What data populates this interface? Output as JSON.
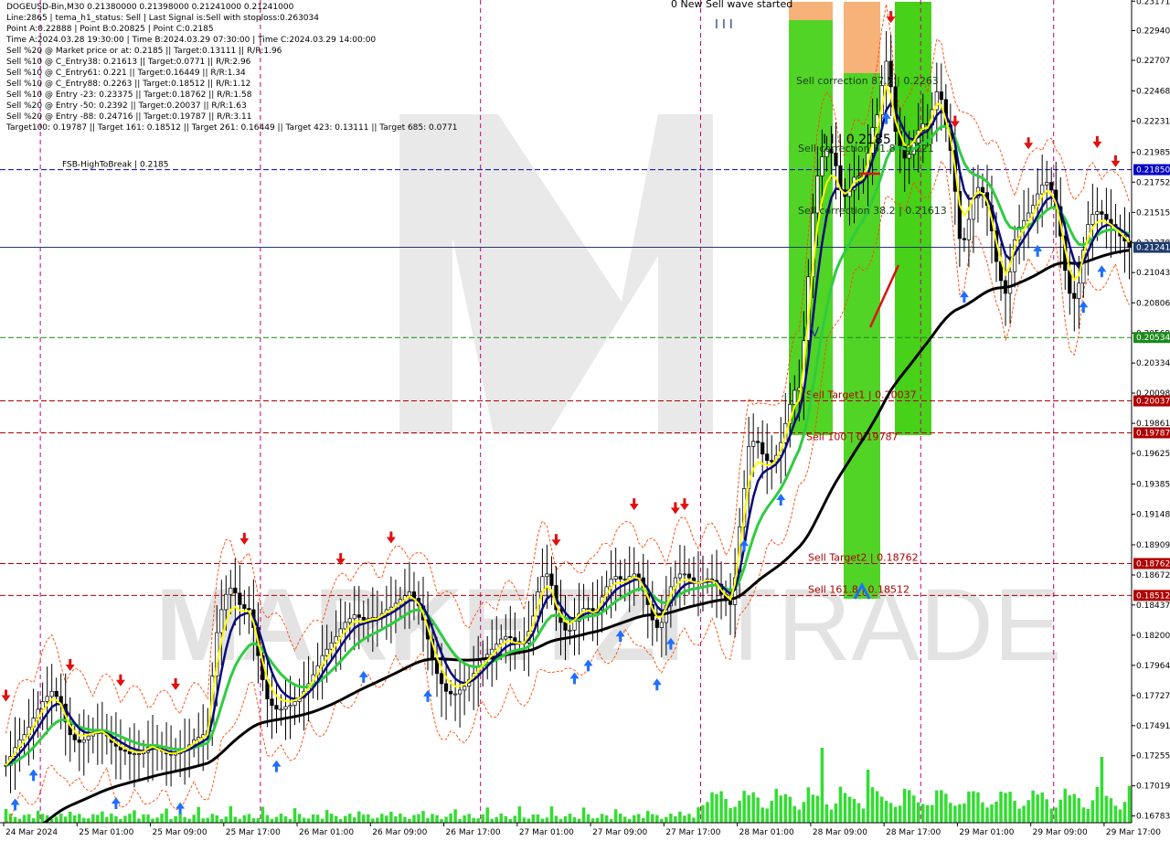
{
  "header": {
    "lines": [
      "DOGEUSD-Bin,M30  0.21380000 0.21398000 0.21241000 0.21241000",
      "Line:2865 | tema_h1_status: Sell | Last Signal is:Sell with stoploss:0.263034",
      "Point A:0.22888 | Point B:0.20825 | Point C:0.2185",
      "Time A:2024.03.28 19:30:00 | Time B:2024.03.29 07:30:00 | Time C:2024.03.29 14:00:00",
      "Sell %20 @ Market price or at: 0.2185 || Target:0.13111 || R/R:1.96",
      "Sell %10 @ C_Entry38: 0.21613 || Target:0.0771 || R/R:2.96",
      "Sell %10 @ C_Entry61: 0.221 || Target:0.16449 || R/R:1.34",
      "Sell %10 @ C_Entry88: 0.2263 || Target:0.18512 || R/R:1.12",
      "Sell %10 @ Entry -23: 0.23375 || Target:0.18762 || R/R:1.58",
      "Sell %20 @ Entry -50: 0.2392 || Target:0.20037 || R/R:1.63",
      "Sell %20 @ Entry -88: 0.24716 || Target:0.19787 || R/R:3.11",
      "Target100: 0.19787 || Target 161: 0.18512 || Target 261: 0.16449 || Target 423: 0.13111 || Target 685: 0.0771"
    ]
  },
  "watermark": {
    "bold": "MARKETZI",
    "light": "TRADE"
  },
  "chart_data": {
    "type": "candlestick",
    "symbol": "DOGEUSD-Bin",
    "timeframe": "M30",
    "ohlc_last": {
      "open": 0.2138,
      "high": 0.21398,
      "low": 0.21241,
      "close": 0.21241
    },
    "current_price": 0.21241,
    "ylim": [
      0.1673,
      0.2318
    ],
    "y_ticks": [
      "0.23171",
      "0.22940",
      "0.22707",
      "0.22468",
      "0.22231",
      "0.21985",
      "0.21752",
      "0.21515",
      "0.21278",
      "0.21043",
      "0.20806",
      "0.20569",
      "0.20334",
      "0.20098",
      "0.19861",
      "0.19625",
      "0.19385",
      "0.19148",
      "0.18909",
      "0.18672",
      "0.18437",
      "0.18200",
      "0.17964",
      "0.17727",
      "0.17491",
      "0.17255",
      "0.17019",
      "0.16783"
    ],
    "y_tick_values": [
      0.23171,
      0.2294,
      0.22707,
      0.22468,
      0.22231,
      0.21985,
      0.21752,
      0.21515,
      0.21278,
      0.21043,
      0.20806,
      0.20569,
      0.20334,
      0.20098,
      0.19861,
      0.19625,
      0.19385,
      0.19148,
      0.18909,
      0.18672,
      0.18437,
      0.182,
      0.17964,
      0.17727,
      0.17491,
      0.17255,
      0.17019,
      0.16783
    ],
    "x_ticks": [
      "24 Mar 2024",
      "25 Mar 01:00",
      "25 Mar 09:00",
      "25 Mar 17:00",
      "26 Mar 01:00",
      "26 Mar 09:00",
      "26 Mar 17:00",
      "27 Mar 01:00",
      "27 Mar 09:00",
      "27 Mar 17:00",
      "28 Mar 01:00",
      "28 Mar 09:00",
      "28 Mar 17:00",
      "29 Mar 01:00",
      "29 Mar 09:00",
      "29 Mar 17:00"
    ],
    "x_tick_bars": [
      0,
      16,
      32,
      48,
      64,
      80,
      96,
      112,
      128,
      144,
      160,
      176,
      192,
      208,
      224,
      240
    ],
    "bar_count": 246,
    "day_separators_bars": [
      8,
      56,
      104,
      152,
      200,
      229
    ],
    "closes": [
      0.1718,
      0.1725,
      0.1732,
      0.1738,
      0.1742,
      0.1748,
      0.1755,
      0.1762,
      0.1768,
      0.1772,
      0.1776,
      0.1772,
      0.1766,
      0.1752,
      0.1742,
      0.1738,
      0.1736,
      0.1738,
      0.1741,
      0.1743,
      0.1744,
      0.1745,
      0.1741,
      0.1736,
      0.1733,
      0.173,
      0.1729,
      0.1727,
      0.1727,
      0.1727,
      0.1728,
      0.1732,
      0.1734,
      0.1731,
      0.1729,
      0.1727,
      0.1726,
      0.1727,
      0.1729,
      0.1731,
      0.1734,
      0.1738,
      0.174,
      0.1742,
      0.1745,
      0.1788,
      0.1822,
      0.184,
      0.1852,
      0.1857,
      0.1853,
      0.1844,
      0.1841,
      0.184,
      0.1826,
      0.1804,
      0.1785,
      0.177,
      0.1765,
      0.1762,
      0.1762,
      0.1764,
      0.1765,
      0.1768,
      0.1771,
      0.1776,
      0.1782,
      0.1789,
      0.1796,
      0.1804,
      0.1809,
      0.1814,
      0.1819,
      0.1825,
      0.183,
      0.1833,
      0.1836,
      0.1834,
      0.1832,
      0.1833,
      0.1834,
      0.1834,
      0.1837,
      0.184,
      0.1842,
      0.1845,
      0.1848,
      0.1851,
      0.1854,
      0.1849,
      0.1843,
      0.1832,
      0.1817,
      0.1802,
      0.179,
      0.1782,
      0.1776,
      0.1774,
      0.1774,
      0.1777,
      0.178,
      0.1785,
      0.179,
      0.1796,
      0.1801,
      0.1805,
      0.1809,
      0.1813,
      0.1817,
      0.1819,
      0.1818,
      0.1815,
      0.1814,
      0.1814,
      0.1823,
      0.1835,
      0.1854,
      0.1866,
      0.1868,
      0.1859,
      0.184,
      0.183,
      0.1824,
      0.1824,
      0.1831,
      0.1837,
      0.1841,
      0.1841,
      0.1838,
      0.184,
      0.185,
      0.1858,
      0.1864,
      0.1866,
      0.1864,
      0.1864,
      0.1866,
      0.1868,
      0.1865,
      0.1855,
      0.1844,
      0.1832,
      0.1826,
      0.183,
      0.1843,
      0.1858,
      0.1865,
      0.1868,
      0.1868,
      0.1865,
      0.1862,
      0.1861,
      0.1862,
      0.1864,
      0.1863,
      0.186,
      0.1852,
      0.1847,
      0.1844,
      0.1865,
      0.1905,
      0.1935,
      0.1968,
      0.1972,
      0.1971,
      0.1962,
      0.1957,
      0.1956,
      0.1961,
      0.1971,
      0.1986,
      0.2001,
      0.2012,
      0.2014,
      0.2051,
      0.2101,
      0.2151,
      0.218,
      0.2195,
      0.2201,
      0.2198,
      0.2188,
      0.2169,
      0.2164,
      0.2169,
      0.2179,
      0.218,
      0.2181,
      0.2198,
      0.2218,
      0.2228,
      0.2251,
      0.227,
      0.225,
      0.2215,
      0.2203,
      0.2194,
      0.2197,
      0.2206,
      0.2216,
      0.2221,
      0.222,
      0.2232,
      0.2246,
      0.224,
      0.222,
      0.22,
      0.2168,
      0.2131,
      0.213,
      0.2146,
      0.2163,
      0.2171,
      0.2167,
      0.2157,
      0.2137,
      0.2113,
      0.2098,
      0.2088,
      0.2105,
      0.213,
      0.214,
      0.2145,
      0.2151,
      0.2157,
      0.2166,
      0.2173,
      0.2175,
      0.2169,
      0.2156,
      0.2133,
      0.2106,
      0.2088,
      0.2084,
      0.2096,
      0.2122,
      0.2142,
      0.215,
      0.2152,
      0.215,
      0.2146,
      0.2142,
      0.2137,
      0.2133,
      0.2129,
      0.2124
    ]
  },
  "levels": [
    {
      "label": "0.21850",
      "value": 0.2185,
      "color": "#0000c8",
      "style": "dashed",
      "text": "FSB-HighToBreak | 0.2185",
      "text_left": true
    },
    {
      "label": "0.21241",
      "value": 0.21241,
      "color": "#1f3a6b",
      "style": "solid",
      "text": ""
    },
    {
      "label": "0.20534",
      "value": 0.20534,
      "color": "#1a8a1a",
      "style": "dashed",
      "text": ""
    },
    {
      "label": "0.20037",
      "value": 0.20037,
      "color": "#b00000",
      "style": "dashed",
      "text": "Sell Target1 | 0.20037"
    },
    {
      "label": "0.19787",
      "value": 0.19787,
      "color": "#b00000",
      "style": "dashed",
      "text": "Sell 100 | 0.19787"
    },
    {
      "label": "0.18762",
      "value": 0.18762,
      "color": "#b00000",
      "style": "dashed",
      "text": "Sell Target2 | 0.18762"
    },
    {
      "label": "0.18512",
      "value": 0.18512,
      "color": "#b00000",
      "style": "dashed",
      "text": "Sell 161.8 | 0.18512"
    }
  ],
  "annotations": {
    "top_text": "0 New Sell wave started",
    "wave_i": "I I I",
    "wave_iv": "I V",
    "correction_875": "Sell correction 87.5 | 0.2263",
    "correction_618": "Sell correction 61.8 | 0.221",
    "correction_38": "Sell correction 38.2 | 0.21613",
    "point_c": "I I I 0.2185"
  },
  "colors": {
    "bull": "#1a1a1a",
    "bear": "#1a1a1a",
    "ema_slow": "#000000",
    "ema_mid": "#2ecc40",
    "ema_fast": "#0a0a7a",
    "tema": "#ffff00",
    "band": "#ff4500",
    "zone_green": "#33cc00",
    "zone_orange": "#f4a460",
    "sep": "#c0007a",
    "volume": "#33dd33"
  }
}
